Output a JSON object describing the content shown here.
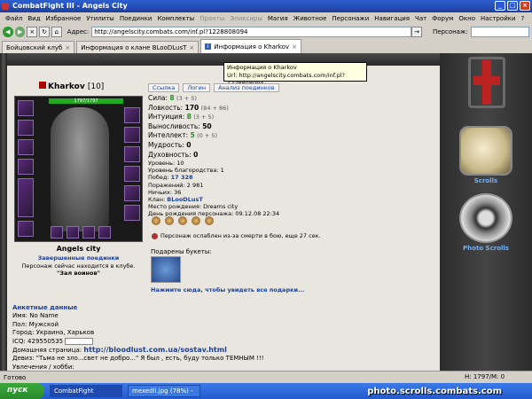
{
  "window": {
    "title": "CombatFight III - Angels City"
  },
  "menu": [
    {
      "label": "Файл",
      "dim": false
    },
    {
      "label": "Вид",
      "dim": false
    },
    {
      "label": "Избранное",
      "dim": false
    },
    {
      "label": "Утилиты",
      "dim": false
    },
    {
      "label": "Поединки",
      "dim": false
    },
    {
      "label": "Комплекты",
      "dim": false
    },
    {
      "label": "Пранты",
      "dim": true
    },
    {
      "label": "Эликсиры",
      "dim": true
    },
    {
      "label": "Магия",
      "dim": false
    },
    {
      "label": "Животное",
      "dim": false
    },
    {
      "label": "Персонажи",
      "dim": false
    },
    {
      "label": "Навигация",
      "dim": false
    },
    {
      "label": "Чат",
      "dim": false
    },
    {
      "label": "Форум",
      "dim": false
    },
    {
      "label": "Окно",
      "dim": false
    },
    {
      "label": "Настройки",
      "dim": false
    },
    {
      "label": "?",
      "dim": false
    }
  ],
  "toolbar": {
    "address_label": "Адрес:",
    "url": "http://angelscity.combats.com/inf.pl?1228808094",
    "person_label": "Персонаж:"
  },
  "tabs": [
    {
      "label": "Бойцовский клуб",
      "active": false
    },
    {
      "label": "Информация о клане BLooDLusT",
      "active": false
    },
    {
      "label": "Информация о Kharkov",
      "active": true
    }
  ],
  "tooltip": {
    "line1": "Информация о Kharkov",
    "line2": "Url: http://angelscity.combats.com/inf.pl?1228808094"
  },
  "character": {
    "name": "Kharkov",
    "level": "[10]",
    "hp": "1797/1797",
    "buttons": [
      "Ссылка",
      "Логин",
      "Анализ поединков"
    ],
    "city": "Angels city",
    "finished": "Завершенные поединки",
    "location_text": "Персонаж сейчас находится в клубе.",
    "location": "\"Зал воинов\""
  },
  "stats": [
    {
      "label": "Сила:",
      "value": "8",
      "extra": "(3 + 5)",
      "green": true
    },
    {
      "label": "Ловкость:",
      "value": "170",
      "extra": "(84 + 86)",
      "green": false
    },
    {
      "label": "Интуиция:",
      "value": "8",
      "extra": "(3 + 5)",
      "green": true
    },
    {
      "label": "Выносливость:",
      "value": "50",
      "extra": "",
      "green": false
    },
    {
      "label": "Интеллект:",
      "value": "5",
      "extra": "(0 + 5)",
      "green": true
    },
    {
      "label": "Мудрость:",
      "value": "0",
      "extra": "",
      "green": false
    },
    {
      "label": "Духовность:",
      "value": "0",
      "extra": "",
      "green": false
    }
  ],
  "info": [
    {
      "label": "Уровень:",
      "value": "10",
      "bold": false
    },
    {
      "label": "Уровень благородства:",
      "value": "1",
      "bold": false
    },
    {
      "label": "Побед:",
      "value": "17 328",
      "bold": true
    },
    {
      "label": "Поражений:",
      "value": "2 981",
      "bold": false
    },
    {
      "label": "Ничьих:",
      "value": "36",
      "bold": false
    },
    {
      "label": "Клан:",
      "value": "BLooDLusT",
      "bold": true
    },
    {
      "label": "Место рождения:",
      "value": "Dreams city",
      "bold": false
    },
    {
      "label": "День рождения персонажа:",
      "value": "09.12.08 22:34",
      "bold": false
    }
  ],
  "weak_text": "Персонаж ослаблен из-за смерти в бою, еще 27 сек.",
  "bouquets": {
    "title": "Подарены букеты:",
    "link": "Нажмите сюда, чтобы увидеть все подарки..."
  },
  "anket": {
    "header": "Анкетные данные",
    "name": "Имя: No Name",
    "gender": "Пол: Мужской",
    "city": "Город: Украина, Харьков",
    "icq": "ICQ: 429550535",
    "home_label": "Домашняя страница:",
    "home_url": "http://bloodlust.com.ua/sostav.html",
    "motto": "Девиз: \"Тьма не зло...свет не добро...\" Я был , есть, буду только ТЕМНЫМ !!!",
    "hobby": "Увлечения / хобби:"
  },
  "sidebar": {
    "scrolls": "Scrolls",
    "photo": "Photo Scrolls"
  },
  "status": {
    "ready": "Готово",
    "pos": "H: 1797/M: 0"
  },
  "taskbar": {
    "start": "пуск",
    "tasks": [
      "CombatFight",
      "mexedli.jpg (78%) -"
    ]
  },
  "watermark": "photo.scrolls.combats.com"
}
